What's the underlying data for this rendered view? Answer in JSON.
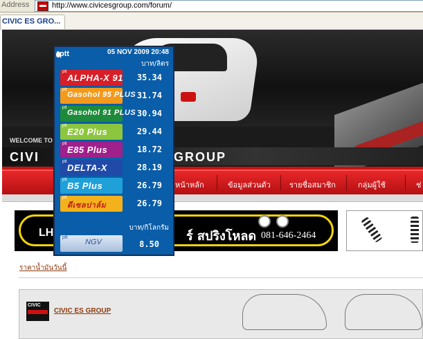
{
  "browser": {
    "address_label": "Address",
    "url": "http://www.civicesgroup.com/forum/",
    "tab_title": "CIVIC ES GRO..."
  },
  "banner": {
    "welcome": "WELCOME TO",
    "logo_left": "CIVI",
    "logo_right": "GROUP"
  },
  "nav": {
    "items": [
      "หน้าหลัก",
      "ข้อมูลส่วนตัว",
      "รายชื่อสมาชิก",
      "กลุ่มผู้ใช้",
      "ช่"
    ]
  },
  "fuel_widget": {
    "date": "05 NOV 2009 20:48",
    "unit_liquid": "บาท/ลิตร",
    "unit_gas": "บาท/กิโลกรัม",
    "brand": "ptt",
    "fuels": [
      {
        "name": "ALPHA-X 91",
        "price": "35.34",
        "color": "#d81e27"
      },
      {
        "name": "Gasohol 95 PLUS",
        "price": "31.74",
        "color": "#f39a1d"
      },
      {
        "name": "Gasohol 91 PLUS",
        "price": "30.94",
        "color": "#1e8a3b"
      },
      {
        "name": "E20 Plus",
        "price": "29.44",
        "color": "#8cc63e"
      },
      {
        "name": "E85 Plus",
        "price": "18.72",
        "color": "#a0208c"
      },
      {
        "name": "DELTA-X",
        "price": "28.19",
        "color": "#1f4aa8"
      },
      {
        "name": "B5 Plus",
        "price": "26.79",
        "color": "#1fa0d8"
      },
      {
        "name": "ดีเซลปาล์ม",
        "price": "26.79",
        "color": "#f3b21c"
      }
    ],
    "ngv": {
      "name": "NGV",
      "price": "8.50"
    }
  },
  "ad": {
    "left_text": "LH",
    "main_text": "ร์ สปริงโหลด",
    "phone": "081-646-2464"
  },
  "page": {
    "price_link": "ราคาน้ำมันวันนี้",
    "group_title": "CIVIC ES GROUP"
  }
}
